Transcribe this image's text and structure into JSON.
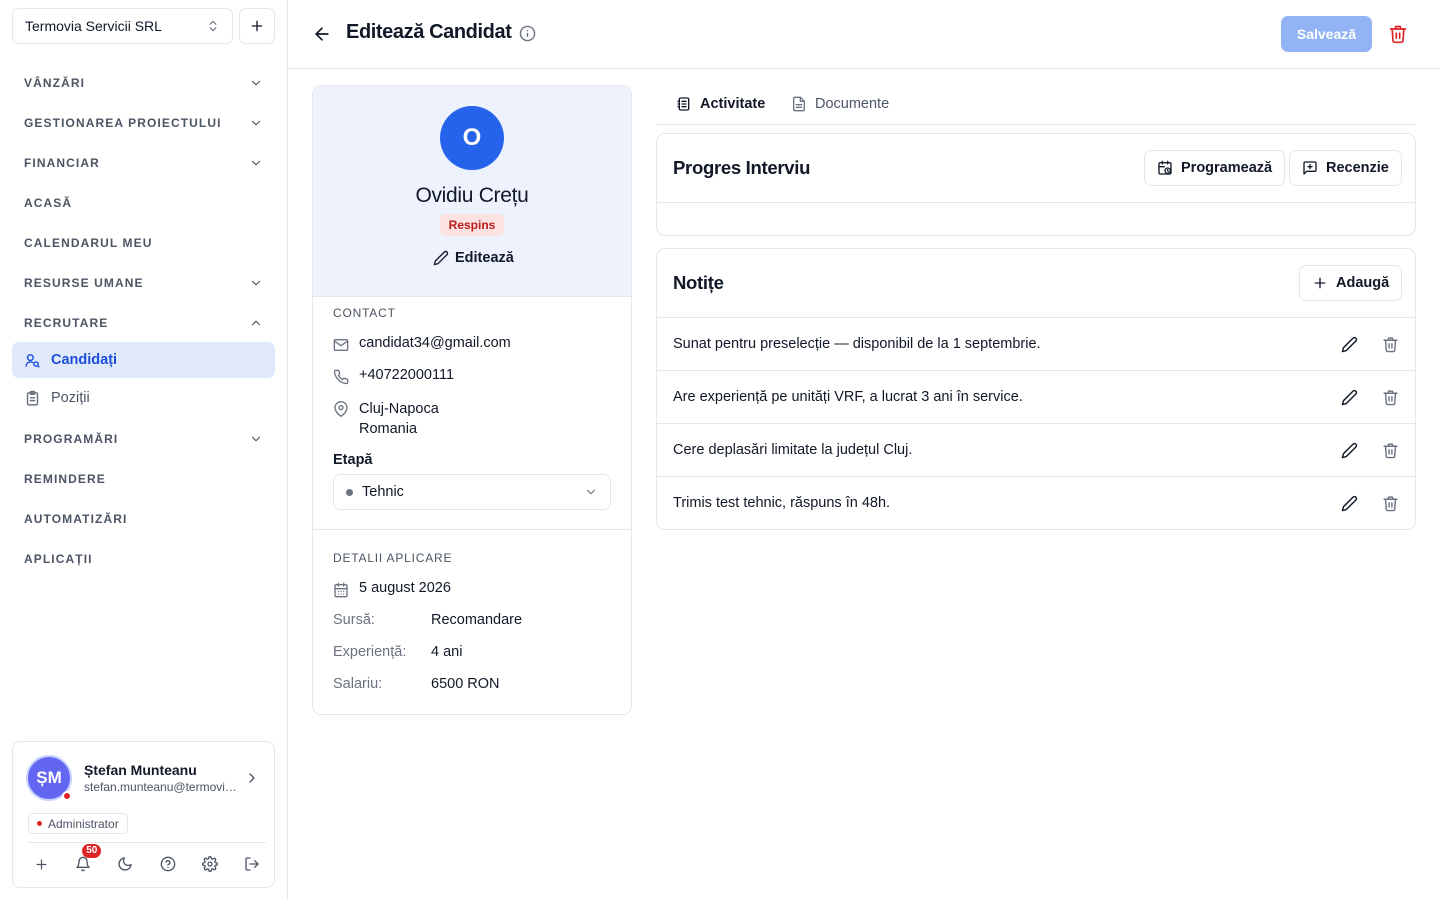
{
  "sidebar": {
    "company": "Termovia Servicii SRL",
    "sections": [
      {
        "label": "VÂNZĂRI",
        "chevron": "down"
      },
      {
        "label": "GESTIONAREA PROIECTULUI",
        "chevron": "down"
      },
      {
        "label": "FINANCIAR",
        "chevron": "down"
      },
      {
        "label": "ACASĂ"
      },
      {
        "label": "CALENDARUL MEU"
      },
      {
        "label": "RESURSE UMANE",
        "chevron": "down"
      },
      {
        "label": "RECRUTARE",
        "chevron": "up"
      },
      {
        "label": "PROGRAMĂRI",
        "chevron": "down"
      },
      {
        "label": "REMINDERE"
      },
      {
        "label": "AUTOMATIZĂRI"
      },
      {
        "label": "APLICAȚII"
      }
    ],
    "recrutare_items": [
      {
        "label": "Candidați",
        "icon": "user-search-icon",
        "active": true
      },
      {
        "label": "Poziții",
        "icon": "clipboard-icon",
        "active": false
      }
    ],
    "user": {
      "initials": "ȘM",
      "name": "Ștefan Munteanu",
      "email": "stefan.munteanu@termovia.ro",
      "role": "Administrator",
      "notifications": "50"
    }
  },
  "header": {
    "title": "Editează Candidat",
    "save_label": "Salvează"
  },
  "profile": {
    "initial": "O",
    "name": "Ovidiu Crețu",
    "status": "Respins",
    "edit_label": "Editează",
    "contact_title": "CONTACT",
    "email": "candidat34@gmail.com",
    "phone": "+40722000111",
    "city": "Cluj-Napoca",
    "country": "Romania",
    "stage_label": "Etapă",
    "stage_value": "Tehnic",
    "details_title": "DETALII APLICARE",
    "applied_date": "5 august 2026",
    "source_label": "Sursă:",
    "source_value": "Recomandare",
    "experience_label": "Experiență:",
    "experience_value": "4 ani",
    "salary_label": "Salariu:",
    "salary_value": "6500 RON"
  },
  "tabs": [
    {
      "label": "Activitate",
      "icon": "activity-list-icon",
      "active": true
    },
    {
      "label": "Documente",
      "icon": "document-icon",
      "active": false
    }
  ],
  "interview": {
    "title": "Progres Interviu",
    "schedule_label": "Programează",
    "review_label": "Recenzie"
  },
  "notes": {
    "title": "Notițe",
    "add_label": "Adaugă",
    "items": [
      "Sunat pentru preselecție — disponibil de la 1 septembrie.",
      "Are experiență pe unități VRF, a lucrat 3 ani în service.",
      "Cere deplasări limitate la județul Cluj.",
      "Trimis test tehnic, răspuns în 48h."
    ]
  },
  "colors": {
    "accent": "#2563eb",
    "active_nav_bg": "#e0e9fb",
    "profile_bg": "#edf2fc",
    "save_disabled": "#93b4f4",
    "danger": "#dc2626"
  }
}
